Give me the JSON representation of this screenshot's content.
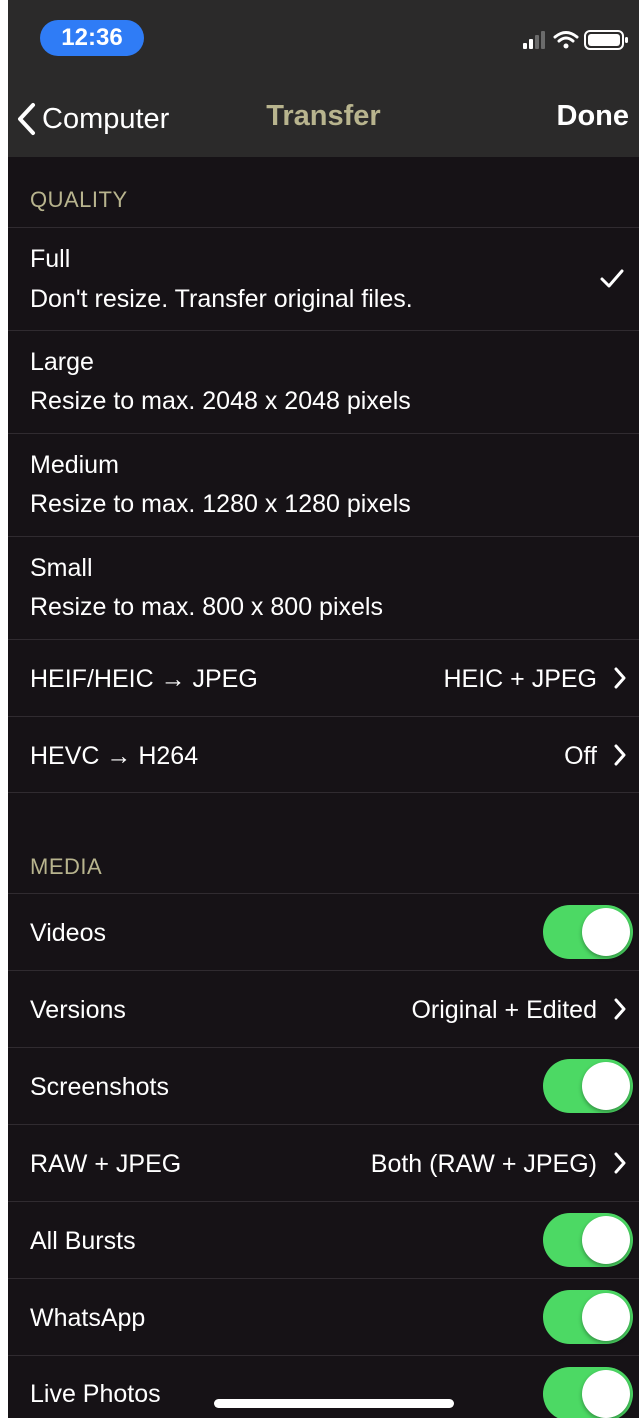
{
  "status_bar": {
    "time": "12:36"
  },
  "nav": {
    "back_label": "Computer",
    "title": "Transfer",
    "done_label": "Done"
  },
  "quality": {
    "header": "QUALITY",
    "options": [
      {
        "title": "Full",
        "subtitle": "Don't resize. Transfer original files.",
        "selected": true
      },
      {
        "title": "Large",
        "subtitle": "Resize to max. 2048 x 2048 pixels",
        "selected": false
      },
      {
        "title": "Medium",
        "subtitle": "Resize to max. 1280 x 1280 pixels",
        "selected": false
      },
      {
        "title": "Small",
        "subtitle": "Resize to max. 800 x 800 pixels",
        "selected": false
      }
    ],
    "conversions": [
      {
        "label": "HEIF/HEIC → JPEG",
        "value": "HEIC + JPEG"
      },
      {
        "label": "HEVC → H264",
        "value": "Off"
      }
    ]
  },
  "media": {
    "header": "MEDIA",
    "items": [
      {
        "label": "Videos",
        "type": "toggle",
        "on": true
      },
      {
        "label": "Versions",
        "type": "disclosure",
        "value": "Original + Edited"
      },
      {
        "label": "Screenshots",
        "type": "toggle",
        "on": true
      },
      {
        "label": "RAW + JPEG",
        "type": "disclosure",
        "value": "Both (RAW + JPEG)"
      },
      {
        "label": "All Bursts",
        "type": "toggle",
        "on": true
      },
      {
        "label": "WhatsApp",
        "type": "toggle",
        "on": true
      },
      {
        "label": "Live Photos",
        "type": "toggle",
        "on": true
      }
    ]
  },
  "colors": {
    "accent_toggle": "#4cd964",
    "title_tint": "#b8b48e",
    "time_pill": "#2f7cf6"
  }
}
